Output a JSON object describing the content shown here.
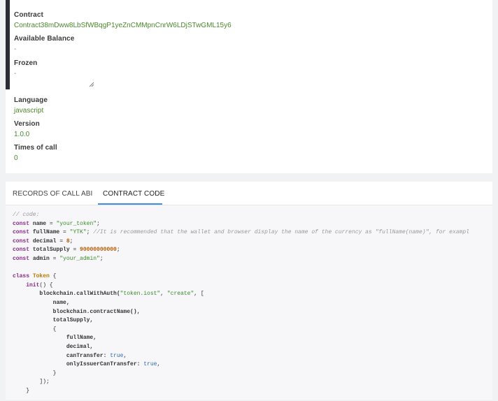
{
  "contract": {
    "label": "Contract",
    "value": "Contract38mDww8LbSfWBqgP1yeZnCMMpnCnrW6LDjSTwGML15y6"
  },
  "available_balance": {
    "label": "Available Balance",
    "value": "-"
  },
  "frozen": {
    "label": "Frozen",
    "value": "-"
  },
  "language": {
    "label": "Language",
    "value": "javascript"
  },
  "version": {
    "label": "Version",
    "value": "1.0.0"
  },
  "times_of_call": {
    "label": "Times of call",
    "value": "0"
  },
  "tabs": [
    {
      "label": "RECORDS OF CALL",
      "active": false
    },
    {
      "label": "ABI",
      "active": false
    },
    {
      "label": "CONTRACT CODE",
      "active": true
    }
  ],
  "code": {
    "comment": "// code:",
    "kw_const": "const",
    "kw_class": "class",
    "name_id": "name",
    "name_val": "\"your_token\"",
    "fullname_id": "fullName",
    "fullname_val": "\"YTK\"",
    "fullname_comment": "//It is recommended that the wallet and browser display the name of the currency as \"fullName(name)\", for exampl",
    "decimal_id": "decimal",
    "decimal_val": "8",
    "supply_id": "totalSupply",
    "supply_val": "90000000000",
    "admin_id": "admin",
    "admin_val": "\"your_admin\"",
    "class_name": "Token",
    "init_call": "init",
    "call_auth": "blockchain.callWithAuth(",
    "token_iost": "\"token.iost\"",
    "create": "\"create\"",
    "line_name": "name,",
    "line_contract": "blockchain.contractName(),",
    "line_supply": "totalSupply,",
    "line_fullname": "fullName,",
    "line_decimal": "decimal,",
    "line_cantransfer": "canTransfer:",
    "line_onlyissuer": "onlyIssuerCanTransfer:",
    "bool_true": "true"
  },
  "colors": {
    "value_green": "#4a8a2a",
    "tab_active_underline": "#3f8fe0",
    "left_bar": "#2a2d35"
  }
}
